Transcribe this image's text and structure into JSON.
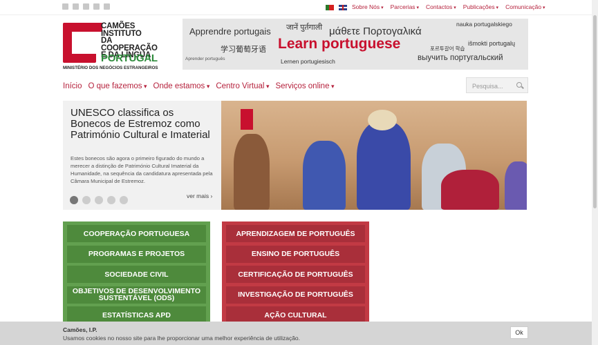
{
  "top_menu": [
    "Sobre Nós",
    "Parcerias",
    "Contactos",
    "Publicações",
    "Comunicação"
  ],
  "social_icons": [
    "facebook-icon",
    "twitter-icon",
    "youtube-icon",
    "linkedin-icon",
    "chat-icon"
  ],
  "flags": [
    "portugal-flag-icon",
    "uk-flag-icon"
  ],
  "logo": {
    "line1": "CAMÕES",
    "line2": "INSTITUTO",
    "line3": "DA COOPERAÇÃO",
    "line4": "E DA LÍNGUA",
    "line5": "PORTUGAL",
    "line6": "MINISTÉRIO DOS NEGÓCIOS ESTRANGEIROS"
  },
  "banner": {
    "main": "Learn portuguese",
    "words": [
      "Apprendre portugais",
      "जानें पुर्तगाली",
      "μάθετε Πορτογαλικά",
      "nauka portugalskiego",
      "学习葡萄牙语",
      "포르투갈어 학습",
      "išmokti portugalų",
      "Aprender português",
      "Lernen portugiesisch",
      "выучить португальский"
    ]
  },
  "nav": {
    "items": [
      "Início",
      "O que fazemos",
      "Onde estamos",
      "Centro Virtual",
      "Serviços online"
    ],
    "search_placeholder": "Pesquisa..."
  },
  "slide": {
    "title": "UNESCO classifica os Bonecos de Estremoz como Património Cultural e Imaterial",
    "text": "Estes bonecos são agora o primeiro figurado do mundo a merecer a distinção de Património Cultural Imaterial da Humanidade, na sequência da candidatura apresentada pela Câmara Municipal de Estremoz.",
    "more": "ver mais",
    "dots": 5,
    "active_dot": 0
  },
  "tiles": {
    "green": [
      "Cooperação Portuguesa",
      "Programas e Projetos",
      "Sociedade Civil",
      "Objetivos de Desenvolvimento Sustentável (ODS)",
      "Estatísticas APD"
    ],
    "red": [
      "Aprendizagem de Português",
      "Ensino de Português",
      "Certificação de Português",
      "Investigação de Português",
      "Ação Cultural"
    ]
  },
  "cookie": {
    "title": "Camões, I.P.",
    "text": "Usamos cookies no nosso site para lhe proporcionar uma melhor experiência de utilização.",
    "ok": "Ok"
  },
  "colors": {
    "brand_red": "#c8102e",
    "brand_green": "#2c8a3a",
    "link": "#b5213c"
  }
}
